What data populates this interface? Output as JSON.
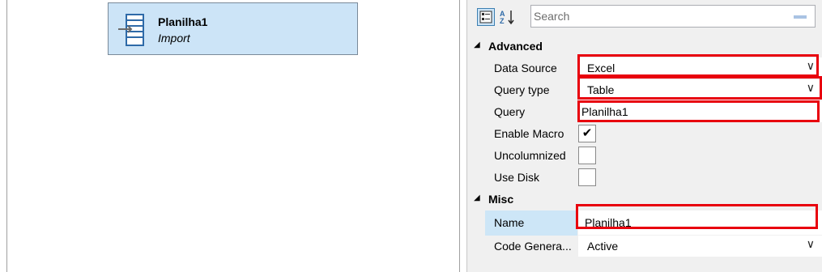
{
  "designer": {
    "node": {
      "title": "Planilha1",
      "subtitle": "Import",
      "icon": "table-import-icon"
    }
  },
  "property_grid": {
    "toolbar": {
      "categorized_icon": "categorized-view-icon",
      "alphabetical_icon": "sort-az-icon"
    },
    "search": {
      "placeholder": "Search",
      "value": ""
    },
    "categories": [
      {
        "label": "Advanced",
        "expanded": true,
        "properties": [
          {
            "name": "Data Source",
            "value": "Excel",
            "editor": "dropdown",
            "highlighted": true
          },
          {
            "name": "Query type",
            "value": "Table",
            "editor": "dropdown",
            "highlighted": true
          },
          {
            "name": "Query",
            "value": "Planilha1",
            "editor": "text",
            "highlighted": true
          },
          {
            "name": "Enable Macro",
            "value": true,
            "editor": "checkbox"
          },
          {
            "name": "Uncolumnized",
            "value": false,
            "editor": "checkbox"
          },
          {
            "name": "Use Disk",
            "value": false,
            "editor": "checkbox"
          }
        ]
      },
      {
        "label": "Misc",
        "expanded": true,
        "properties": [
          {
            "name": "Name",
            "value": "Planilha1",
            "editor": "text",
            "highlighted": true,
            "selected": true
          },
          {
            "name": "Code Genera...",
            "value": "Active",
            "editor": "dropdown"
          }
        ]
      }
    ]
  },
  "colors": {
    "node_fill": "#cce4f7",
    "selected_row": "#cde6f7",
    "highlight_border": "#e8000e"
  }
}
